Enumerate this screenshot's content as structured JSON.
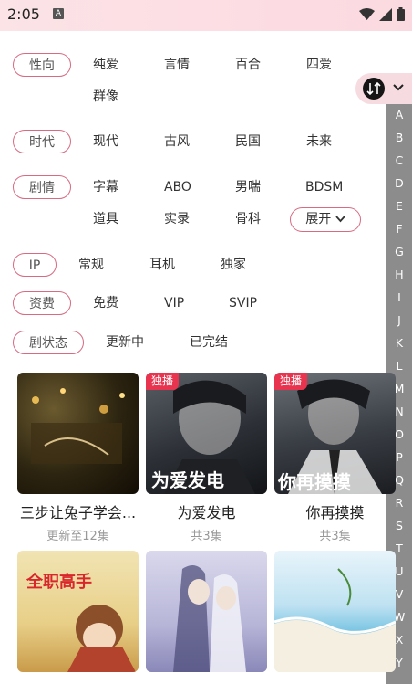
{
  "status_bar": {
    "time": "2:05",
    "app_icon": "A"
  },
  "filters": {
    "orientation": {
      "label": "性向",
      "options": [
        "纯爱",
        "言情",
        "百合",
        "四爱",
        "群像"
      ]
    },
    "era": {
      "label": "时代",
      "options": [
        "现代",
        "古风",
        "民国",
        "未来"
      ]
    },
    "plot": {
      "label": "剧情",
      "options": [
        "字幕",
        "ABO",
        "男喘",
        "BDSM",
        "道具",
        "实录",
        "骨科"
      ],
      "expand": "展开"
    },
    "ip": {
      "label": "IP",
      "options": [
        "常规",
        "耳机",
        "独家"
      ]
    },
    "fee": {
      "label": "资费",
      "options": [
        "免费",
        "VIP",
        "SVIP"
      ]
    },
    "status": {
      "label": "剧状态",
      "options": [
        "更新中",
        "已完结"
      ]
    }
  },
  "alphabet": [
    "A",
    "B",
    "C",
    "D",
    "E",
    "F",
    "G",
    "H",
    "I",
    "J",
    "K",
    "L",
    "M",
    "N",
    "O",
    "P",
    "Q",
    "R",
    "S",
    "T",
    "U",
    "V",
    "W",
    "X",
    "Y"
  ],
  "cards": [
    {
      "title": "三步让兔子学会...",
      "sub": "更新至12集",
      "badge": "",
      "cover_text": ""
    },
    {
      "title": "为爱发电",
      "sub": "共3集",
      "badge": "独播",
      "cover_text": "为爱发电"
    },
    {
      "title": "你再摸摸",
      "sub": "共3集",
      "badge": "独播",
      "cover_text": "你再摸摸"
    },
    {
      "title": "",
      "sub": "",
      "badge": "",
      "cover_text": "全职高手"
    },
    {
      "title": "",
      "sub": "",
      "badge": "",
      "cover_text": ""
    },
    {
      "title": "",
      "sub": "",
      "badge": "",
      "cover_text": ""
    }
  ],
  "colors": {
    "accent": "#d86a82",
    "badge": "#e8344f",
    "alpha_bar": "#8c8c8c"
  }
}
